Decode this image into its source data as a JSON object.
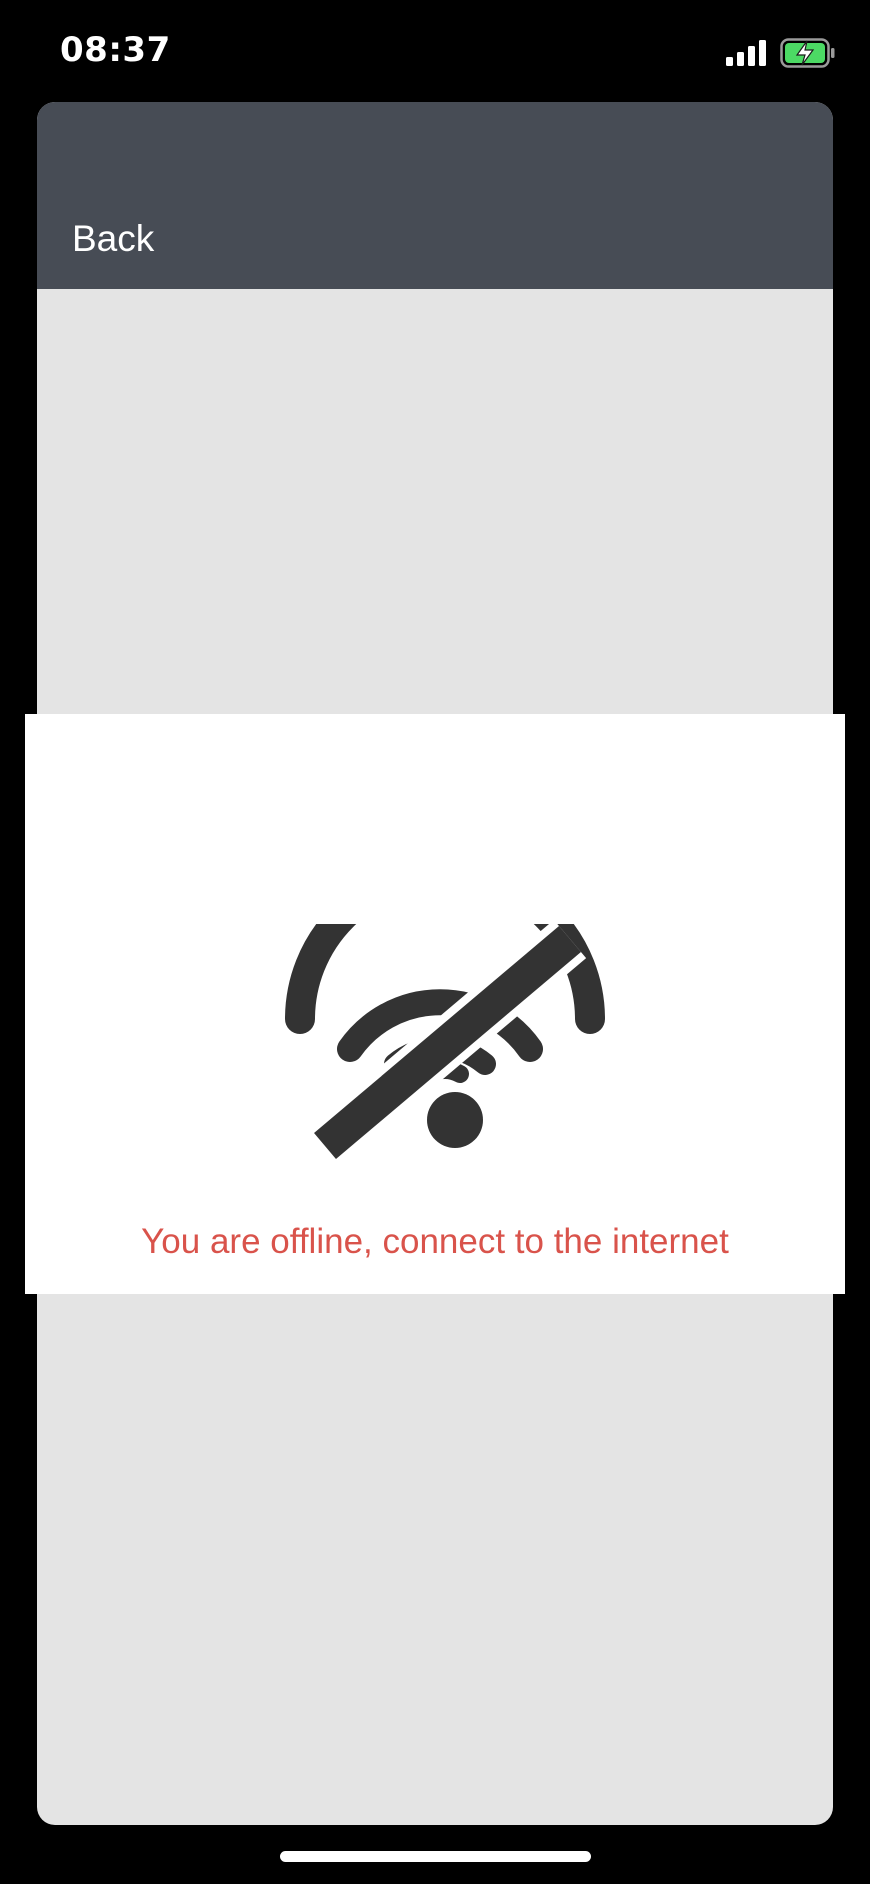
{
  "status_bar": {
    "time": "08:37",
    "signal_icon": "cellular-signal-icon",
    "battery_icon": "battery-charging-icon",
    "battery_color": "#4cd964"
  },
  "header": {
    "back_label": "Back",
    "background_color": "#474c55"
  },
  "offline": {
    "icon": "wifi-off-icon",
    "message": "You are offline, connect to the internet",
    "message_color": "#d9534b"
  }
}
